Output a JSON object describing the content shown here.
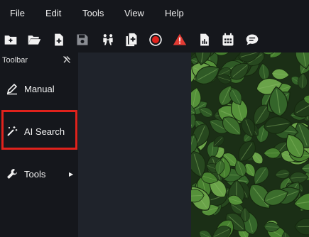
{
  "menubar": {
    "items": [
      "File",
      "Edit",
      "Tools",
      "View",
      "Help"
    ]
  },
  "toolbar_icons": [
    "new-folder-icon",
    "open-folder-icon",
    "new-file-icon",
    "save-icon",
    "people-icon",
    "copy-add-icon",
    "record-icon",
    "warning-icon",
    "report-icon",
    "calendar-icon",
    "chat-icon"
  ],
  "colors": {
    "background": "#15171c",
    "panel": "#1f232b",
    "highlight": "#e0221c",
    "record": "#e0221c",
    "warning": "#e23b33"
  },
  "sidebar": {
    "title": "Toolbar",
    "items": [
      {
        "label": "Manual",
        "icon": "pencil-icon"
      },
      {
        "label": "AI Search",
        "icon": "magic-wand-icon"
      },
      {
        "label": "Tools",
        "icon": "wrench-icon",
        "submenu": true
      }
    ]
  },
  "image": {
    "subject": "dense green ivy leaves"
  }
}
